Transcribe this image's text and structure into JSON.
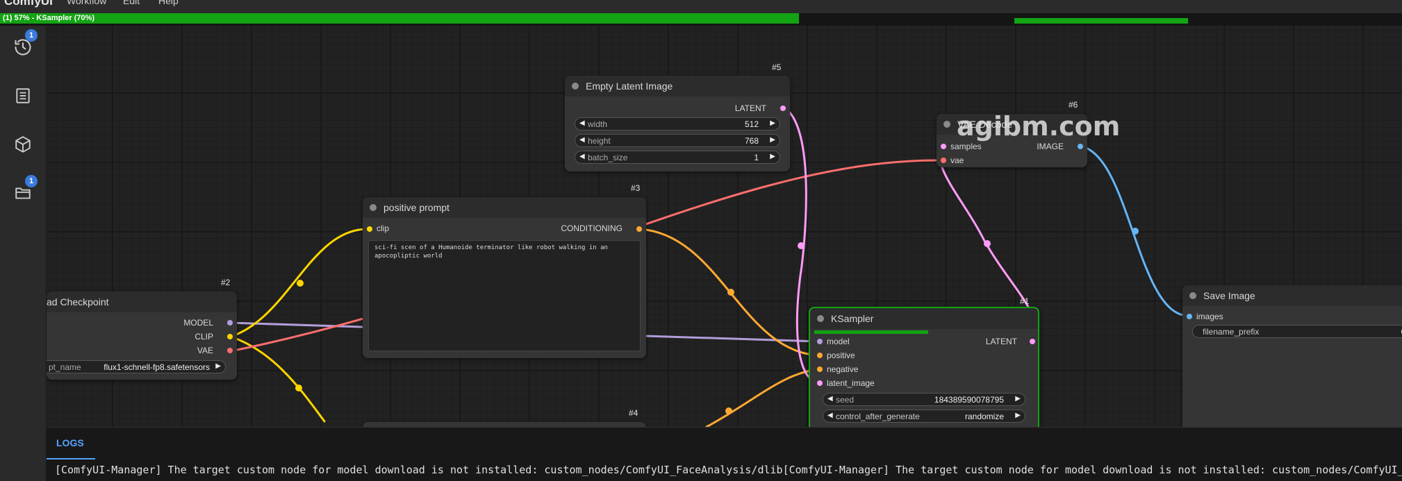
{
  "menubar": {
    "brand": "ComfyUI",
    "items": [
      "Workflow",
      "Edit",
      "Help"
    ]
  },
  "progress": {
    "text": "(1) 57% - KSampler (70%)",
    "fraction": 0.57,
    "step_fraction": 0.7
  },
  "sidebar": {
    "items": [
      {
        "icon": "history-icon",
        "badge": "1"
      },
      {
        "icon": "queue-list-icon",
        "badge": ""
      },
      {
        "icon": "model-library-icon",
        "badge": ""
      },
      {
        "icon": "workflows-folder-icon",
        "badge": "1"
      }
    ]
  },
  "nodes": {
    "checkpoint": {
      "id": "#2",
      "title": "ad Checkpoint",
      "outputs": [
        "MODEL",
        "CLIP",
        "VAE"
      ],
      "widget_label": "pt_name",
      "widget_value": "flux1-schnell-fp8.safetensors"
    },
    "positive": {
      "id": "#3",
      "title": "positive prompt",
      "input": "clip",
      "output": "CONDITIONING",
      "text": "sci-fi scen of a Humanoide terminator like robot walking in an apocopliptic world"
    },
    "latent": {
      "id": "#5",
      "title": "Empty Latent Image",
      "output": "LATENT",
      "widgets": [
        {
          "label": "width",
          "value": "512"
        },
        {
          "label": "height",
          "value": "768"
        },
        {
          "label": "batch_size",
          "value": "1"
        }
      ]
    },
    "vae_decode": {
      "id": "#6",
      "title": "VAE Decode",
      "inputs": [
        "samples",
        "vae"
      ],
      "output": "IMAGE"
    },
    "ksampler": {
      "id": "#1",
      "title": "KSampler",
      "inputs": [
        "model",
        "positive",
        "negative",
        "latent_image"
      ],
      "output": "LATENT",
      "widgets": [
        {
          "label": "seed",
          "value": "184389590078795"
        },
        {
          "label": "control_after_generate",
          "value": "randomize"
        }
      ],
      "progress": 0.7
    },
    "negative": {
      "id": "#4"
    },
    "save": {
      "title": "Save Image",
      "input": "images",
      "widget_label": "filename_prefix",
      "widget_value": "C"
    }
  },
  "watermark": "agibm.com",
  "logs": {
    "tab": "LOGS",
    "text": "[ComfyUI-Manager] The target custom node for model download is not installed: custom_nodes/ComfyUI_FaceAnalysis/dlib[ComfyUI-Manager] The target custom node for model download is not installed: custom_nodes/ComfyUI_FaceAnalysis/dlib"
  },
  "colors": {
    "model": "#b39ddb",
    "clip": "#ffd500",
    "vae": "#ff6e6e",
    "conditioning": "#ffa931",
    "latent": "#ff9cf9",
    "image": "#64b5f6",
    "progress": "#13a313"
  }
}
